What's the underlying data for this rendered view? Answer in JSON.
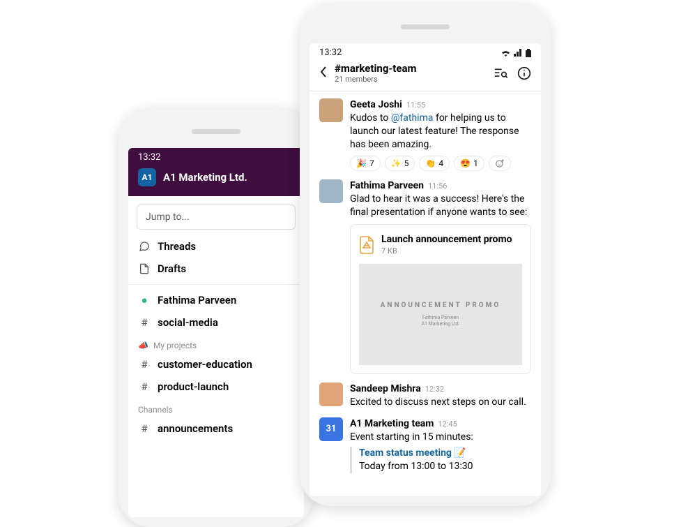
{
  "status_time": "13:32",
  "left": {
    "workspace_abbrev": "A1",
    "workspace_name": "A1 Marketing Ltd.",
    "jump_placeholder": "Jump to...",
    "threads_label": "Threads",
    "drafts_label": "Drafts",
    "dm_name": "Fathima Parveen",
    "channels_quick": [
      "social-media"
    ],
    "section_projects": "My projects",
    "project_channels": [
      "customer-education",
      "product-launch"
    ],
    "section_channels": "Channels",
    "more_channels": [
      "announcements"
    ]
  },
  "right": {
    "channel_name": "marketing-team",
    "channel_members": "21 members",
    "messages": [
      {
        "author": "Geeta Joshi",
        "time": "11:55",
        "text_pre": "Kudos to ",
        "mention": "@fathima",
        "text_post": " for helping us to launch our latest feature! The response has been amazing.",
        "reactions": [
          {
            "emoji": "🎉",
            "count": 7
          },
          {
            "emoji": "✨",
            "count": 5
          },
          {
            "emoji": "👏",
            "count": 4
          },
          {
            "emoji": "😍",
            "count": 1
          }
        ]
      },
      {
        "author": "Fathima Parveen",
        "time": "11:56",
        "text": "Glad to hear it was a success! Here's the final presentation if anyone wants to see:",
        "attachment": {
          "title": "Launch announcement promo",
          "size": "7 KB",
          "preview_title": "ANNOUNCEMENT PROMO",
          "preview_author": "Fathima Parveen",
          "preview_org": "A1 Marketing Ltd."
        }
      },
      {
        "author": "Sandeep Mishra",
        "time": "12:32",
        "text": "Excited to discuss next steps on our call."
      },
      {
        "author": "A1 Marketing team",
        "time": "12:45",
        "is_app": true,
        "cal_day": "31",
        "text": "Event starting in 15 minutes:",
        "event": {
          "title": "Team status meeting",
          "title_emoji": "📝",
          "when": "Today from 13:00 to 13:30"
        }
      }
    ]
  }
}
